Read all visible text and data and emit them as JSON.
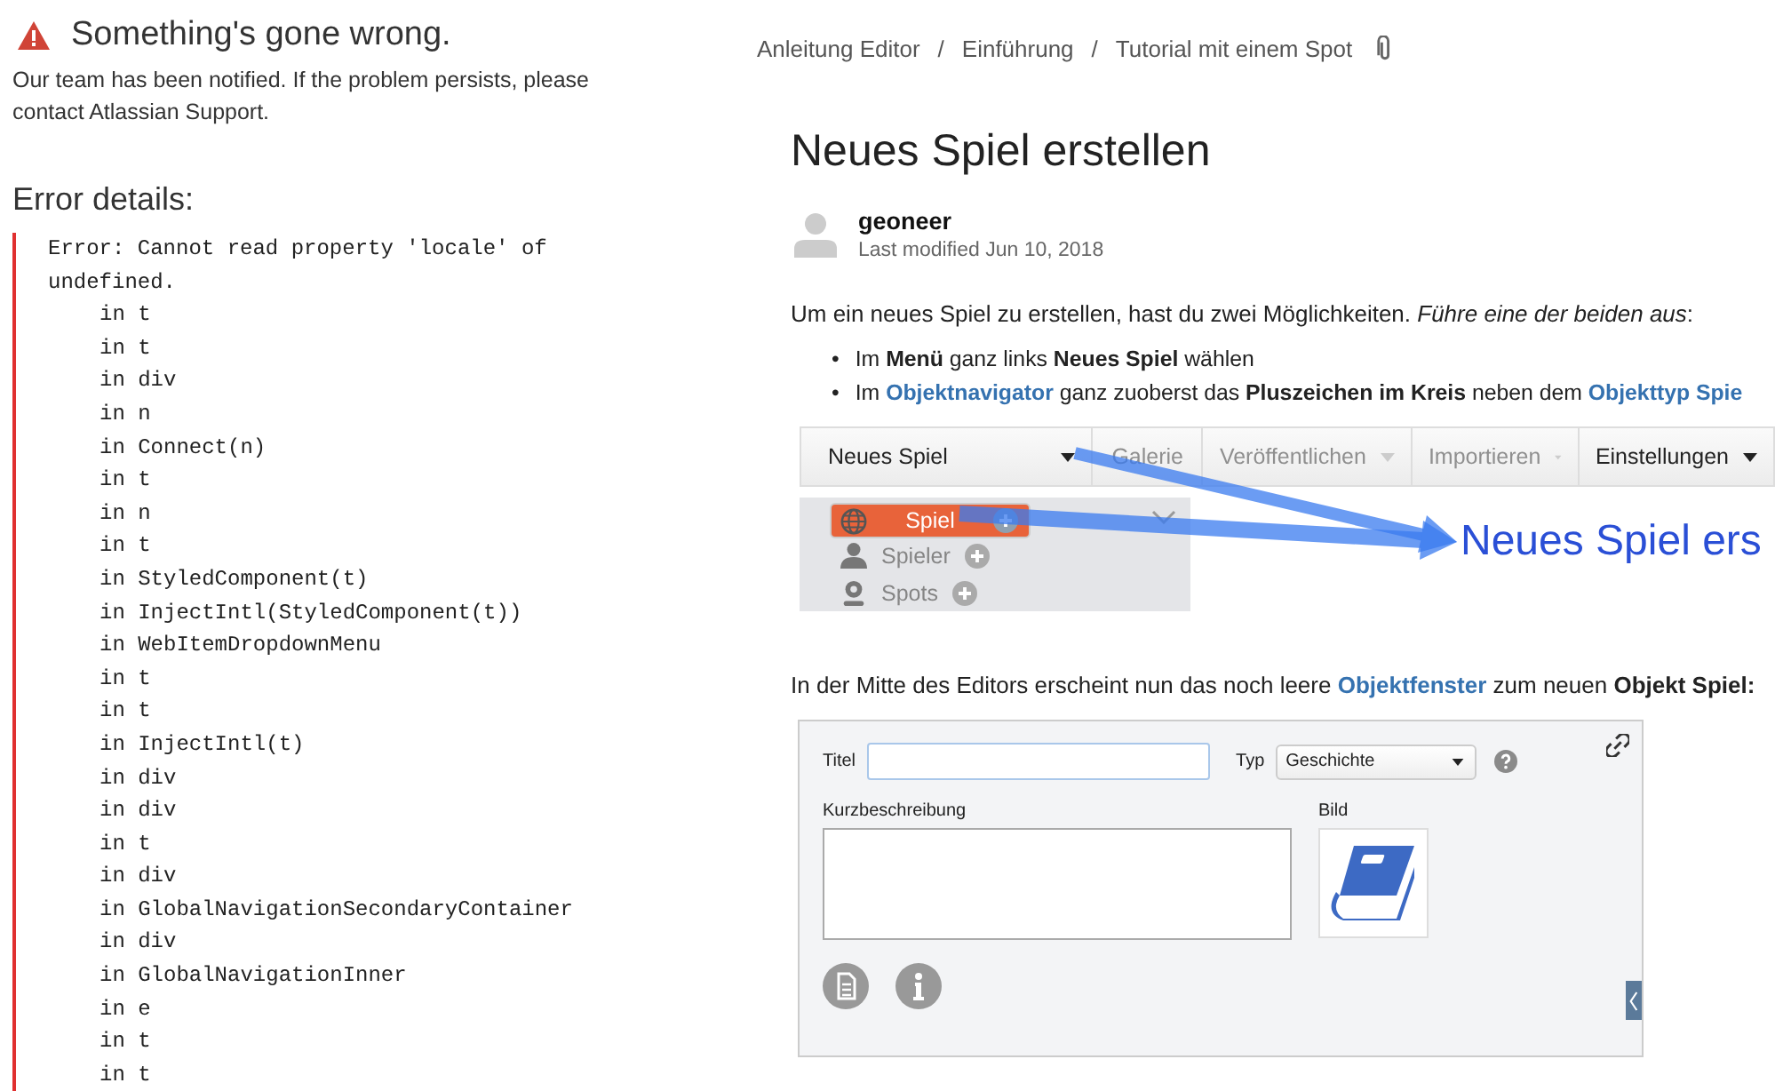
{
  "error": {
    "title": "Something's gone wrong.",
    "message": "Our team has been notified. If the problem persists, please contact Atlassian Support.",
    "details_heading": "Error details:",
    "stack": [
      "Error: Cannot read property 'locale' of undefined.",
      "in t",
      "in t",
      "in div",
      "in n",
      "in Connect(n)",
      "in t",
      "in n",
      "in t",
      "in StyledComponent(t)",
      "in InjectIntl(StyledComponent(t))",
      "in WebItemDropdownMenu",
      "in t",
      "in t",
      "in InjectIntl(t)",
      "in div",
      "in div",
      "in t",
      "in div",
      "in GlobalNavigationSecondaryContainer",
      "in div",
      "in GlobalNavigationInner",
      "in e",
      "in t",
      "in t"
    ]
  },
  "breadcrumbs": {
    "separator": "/",
    "items": [
      "Anleitung Editor",
      "Einführung",
      "Tutorial mit einem Spot"
    ]
  },
  "page": {
    "title": "Neues Spiel erstellen",
    "author": "geoneer",
    "last_modified": "Last modified Jun 10, 2018",
    "intro": [
      {
        "kind": "text",
        "text": "Um ein neues Spiel zu erstellen, hast du zwei Möglichkeiten. *Führe eine der beiden aus*:"
      }
    ],
    "bullet": "•",
    "steps": [
      [
        {
          "kind": "text",
          "text": "Im **Menü** ganz links **Neues Spiel** wählen"
        }
      ],
      [
        {
          "kind": "text",
          "text": "Im "
        },
        {
          "kind": "link",
          "text": "Objektnavigator"
        },
        {
          "kind": "text",
          "text": " ganz zuoberst das **Pluszeichen im Kreis** neben dem "
        },
        {
          "kind": "link",
          "text": "Objekttyp Spie"
        }
      ]
    ],
    "paragraph": [
      {
        "kind": "text",
        "text": "In der Mitte des Editors erscheint nun das noch leere "
      },
      {
        "kind": "link",
        "text": "Objektfenster"
      },
      {
        "kind": "text",
        "text": " zum neuen **Objekt Spiel:**"
      }
    ]
  },
  "screenshot_menu": {
    "toolbar": [
      {
        "label": "Neues Spiel",
        "disabled": false,
        "dropdown": true
      },
      {
        "label": "Galerie",
        "disabled": true,
        "dropdown": false
      },
      {
        "label": "Veröffentlichen",
        "disabled": true,
        "dropdown": true
      },
      {
        "label": "Importieren",
        "disabled": true,
        "dropdown": true
      },
      {
        "label": "Einstellungen",
        "disabled": false,
        "dropdown": true
      }
    ],
    "tree": [
      {
        "label": "Spiel",
        "kind": "game",
        "selected": true
      },
      {
        "label": "Spieler",
        "kind": "player",
        "selected": false
      },
      {
        "label": "Spots",
        "kind": "spot",
        "selected": false
      }
    ],
    "callout": "Neues Spiel ers"
  },
  "screenshot_form": {
    "title_label": "Titel",
    "type_label": "Typ",
    "type_value": "Geschichte",
    "description_label": "Kurzbeschreibung",
    "image_label": "Bild"
  }
}
